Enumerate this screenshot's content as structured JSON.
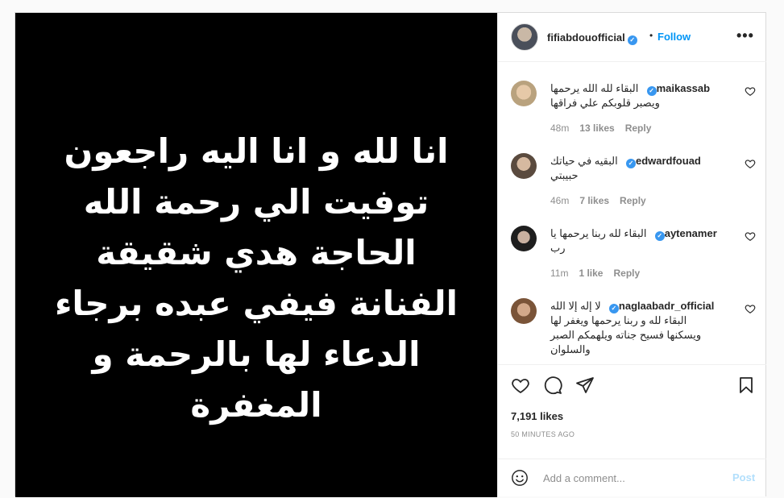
{
  "media": {
    "lines": [
      "انا لله و انا اليه راجعون",
      "توفيت الي رحمة الله",
      "الحاجة هدي شقيقة",
      "الفنانة فيفي عبده برجاء",
      "الدعاء لها بالرحمة و",
      "المغفرة"
    ]
  },
  "header": {
    "username": "fifiabdouofficial",
    "separator": "•",
    "follow_label": "Follow",
    "more_label": "•••"
  },
  "comments": [
    {
      "username": "maikassab",
      "lines": [
        "البقاء لله الله يرحمها",
        "ويصبر قلوبكم علي فراقها"
      ],
      "time": "48m",
      "likes": "13 likes",
      "reply": "Reply"
    },
    {
      "username": "edwardfouad",
      "lines": [
        "البقيه في حياتك",
        "حبيبتي"
      ],
      "time": "46m",
      "likes": "7 likes",
      "reply": "Reply"
    },
    {
      "username": "aytenamer",
      "lines": [
        "البقاء لله ربنا يرحمها يا",
        "رب"
      ],
      "time": "11m",
      "likes": "1 like",
      "reply": "Reply"
    },
    {
      "username": "naglaabadr_official",
      "lines": [
        "لا إله إلا الله",
        "البقاء لله و ربنا يرحمها ويغفر لها",
        "ويسكنها فسيح جناته ويلهمكم الصبر",
        "والسلوان"
      ],
      "time": "",
      "likes": "",
      "reply": ""
    }
  ],
  "likes": "7,191 likes",
  "time_ago": "50 MINUTES AGO",
  "add_comment": {
    "placeholder": "Add a comment...",
    "post_label": "Post"
  },
  "colors": {
    "accent": "#0095f6",
    "verified": "#3897f0",
    "muted": "#8e8e8e"
  }
}
